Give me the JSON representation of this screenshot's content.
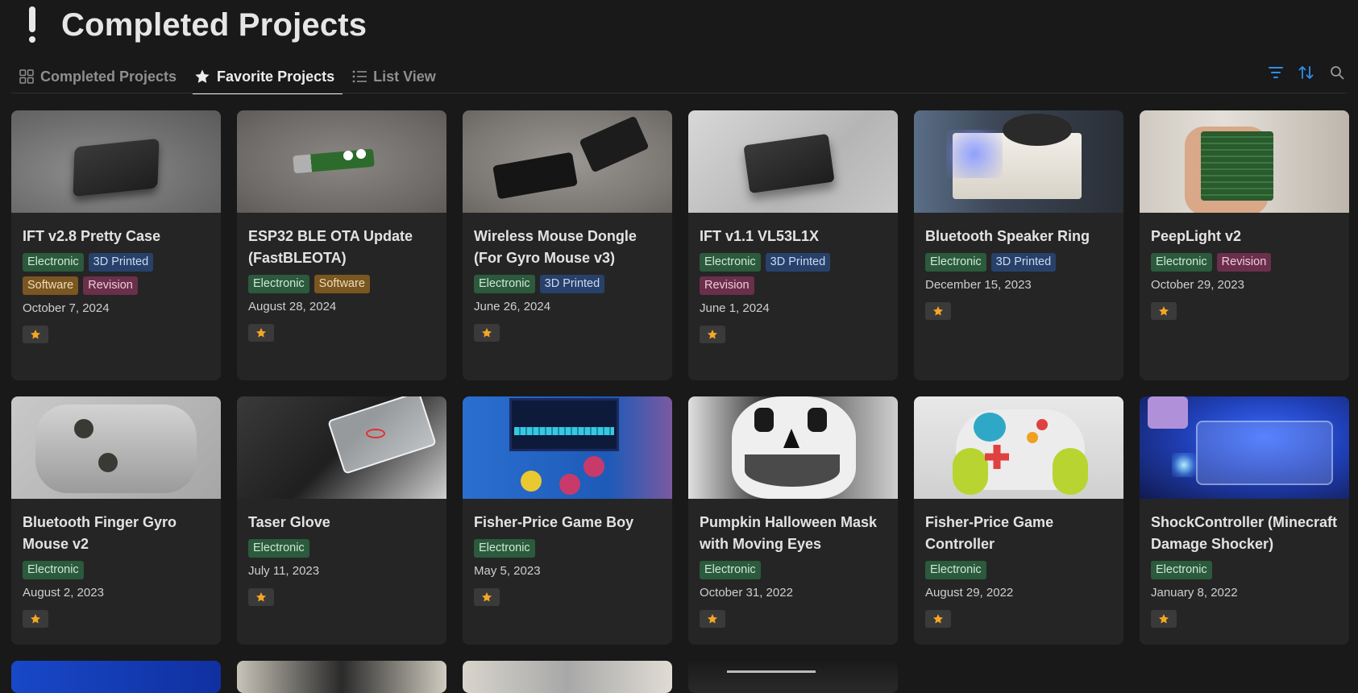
{
  "page": {
    "title": "Completed Projects"
  },
  "tabs": [
    {
      "label": "Completed Projects",
      "icon": "gallery-icon",
      "active": false
    },
    {
      "label": "Favorite Projects",
      "icon": "star-icon",
      "active": true
    },
    {
      "label": "List View",
      "icon": "list-icon",
      "active": false
    }
  ],
  "toolbar": {
    "icons": [
      "filter-icon",
      "sort-icon",
      "search-icon"
    ],
    "accent": "#2f8ef0"
  },
  "tag_colors": {
    "Electronic": "#2b5a3c",
    "3D Printed": "#28416b",
    "Software": "#7a5620",
    "Revision": "#6a2f4a"
  },
  "favorite_star_color": "#f5a623",
  "cards": [
    {
      "title": "IFT v2.8 Pretty Case",
      "tags": [
        "Electronic",
        "3D Printed",
        "Software",
        "Revision"
      ],
      "date": "October 7, 2024",
      "favorite": "★"
    },
    {
      "title": "ESP32 BLE OTA Update (FastBLEOTA)",
      "tags": [
        "Electronic",
        "Software"
      ],
      "date": "August 28, 2024",
      "favorite": "★"
    },
    {
      "title": "Wireless Mouse Dongle (For Gyro Mouse v3)",
      "tags": [
        "Electronic",
        "3D Printed"
      ],
      "date": "June 26, 2024",
      "favorite": "★"
    },
    {
      "title": "IFT v1.1 VL53L1X",
      "tags": [
        "Electronic",
        "3D Printed",
        "Revision"
      ],
      "date": "June 1, 2024",
      "favorite": "★"
    },
    {
      "title": "Bluetooth Speaker Ring",
      "tags": [
        "Electronic",
        "3D Printed"
      ],
      "date": "December 15, 2023",
      "favorite": "★"
    },
    {
      "title": "PeepLight v2",
      "tags": [
        "Electronic",
        "Revision"
      ],
      "date": "October 29, 2023",
      "favorite": "★"
    },
    {
      "title": "Bluetooth Finger Gyro Mouse v2",
      "tags": [
        "Electronic"
      ],
      "date": "August 2, 2023",
      "favorite": "★"
    },
    {
      "title": "Taser Glove",
      "tags": [
        "Electronic"
      ],
      "date": "July 11, 2023",
      "favorite": "★"
    },
    {
      "title": "Fisher-Price Game Boy",
      "tags": [
        "Electronic"
      ],
      "date": "May 5, 2023",
      "favorite": "★"
    },
    {
      "title": "Pumpkin Halloween Mask with Moving Eyes",
      "tags": [
        "Electronic"
      ],
      "date": "October 31, 2022",
      "favorite": "★"
    },
    {
      "title": "Fisher-Price Game Controller",
      "tags": [
        "Electronic"
      ],
      "date": "August 29, 2022",
      "favorite": "★"
    },
    {
      "title": "ShockController (Minecraft Damage Shocker)",
      "tags": [
        "Electronic"
      ],
      "date": "January 8, 2022",
      "favorite": "★"
    }
  ]
}
